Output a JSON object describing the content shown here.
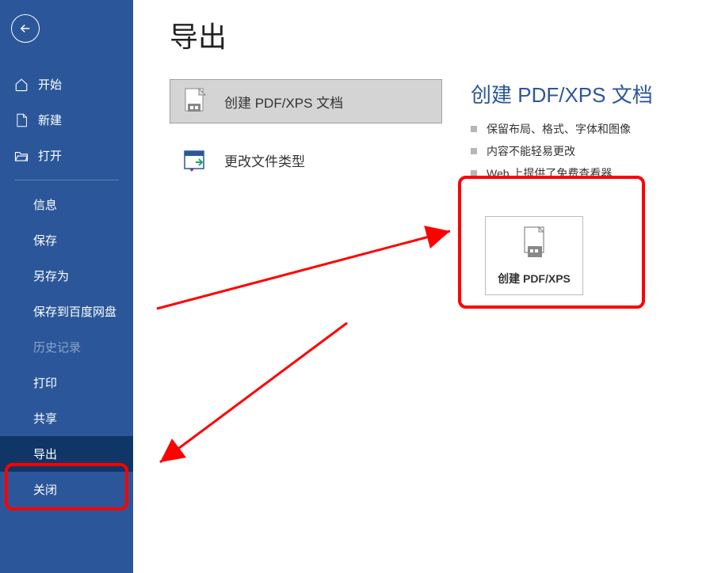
{
  "sidebar": {
    "items": [
      {
        "label": "开始",
        "icon": "home"
      },
      {
        "label": "新建",
        "icon": "file"
      },
      {
        "label": "打开",
        "icon": "folder"
      }
    ],
    "items2": [
      {
        "label": "信息"
      },
      {
        "label": "保存"
      },
      {
        "label": "另存为"
      },
      {
        "label": "保存到百度网盘"
      },
      {
        "label": "历史记录",
        "disabled": true
      },
      {
        "label": "打印"
      },
      {
        "label": "共享"
      },
      {
        "label": "导出",
        "selected": true
      },
      {
        "label": "关闭"
      }
    ]
  },
  "main": {
    "title": "导出",
    "options": [
      {
        "label": "创建 PDF/XPS 文档",
        "icon": "pdf",
        "selected": true
      },
      {
        "label": "更改文件类型",
        "icon": "changetype"
      }
    ],
    "detail": {
      "title": "创建 PDF/XPS 文档",
      "bullets": [
        "保留布局、格式、字体和图像",
        "内容不能轻易更改",
        "Web 上提供了免费查看器"
      ],
      "action_label": "创建 PDF/XPS"
    }
  }
}
